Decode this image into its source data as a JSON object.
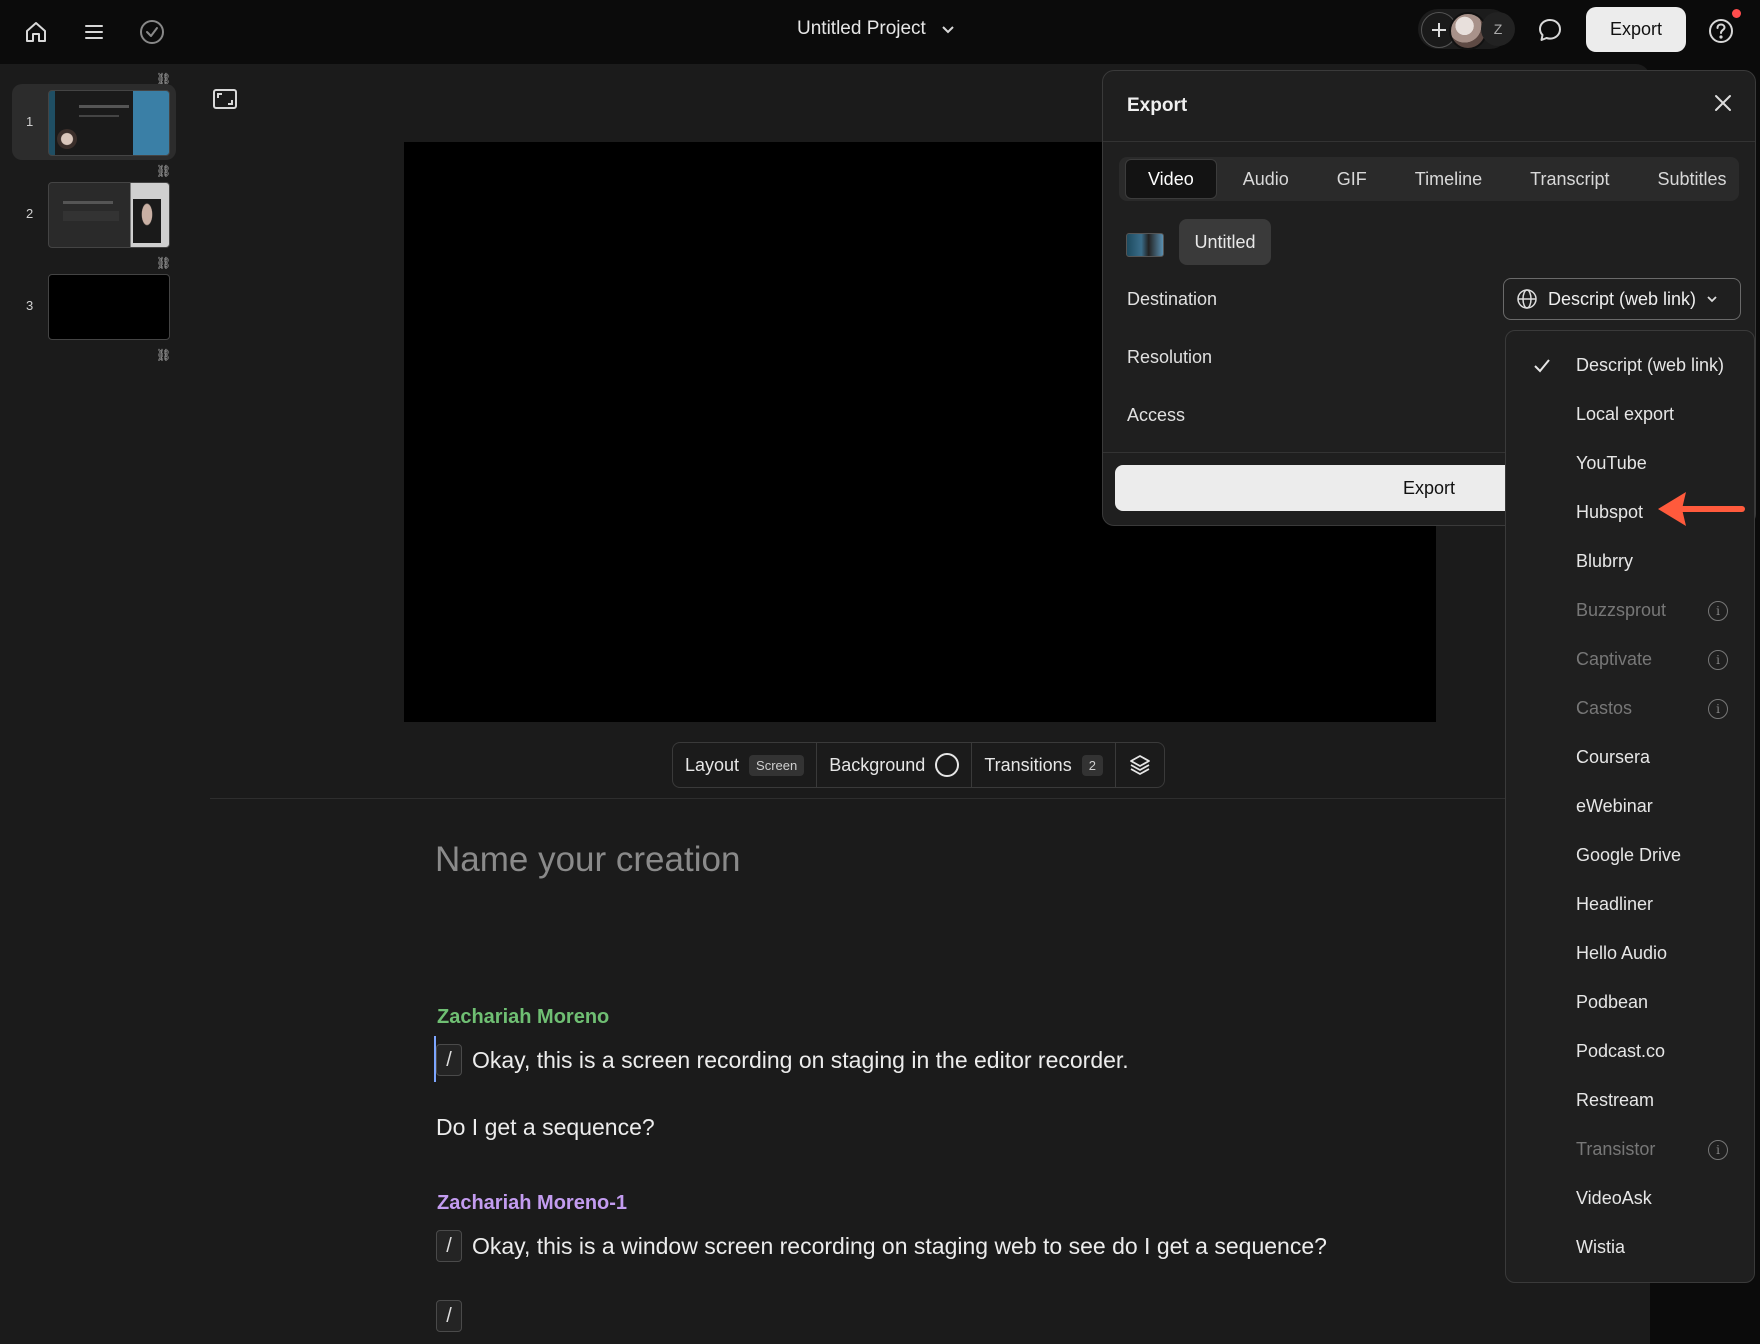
{
  "topbar": {
    "project_title": "Untitled Project",
    "avatar_initial": "Z",
    "export_label": "Export"
  },
  "slides": [
    {
      "number": "1",
      "active": true
    },
    {
      "number": "2",
      "active": false
    },
    {
      "number": "3",
      "active": false
    }
  ],
  "canvas_controls": {
    "layout_label": "Layout",
    "layout_value": "Screen",
    "background_label": "Background",
    "transitions_label": "Transitions",
    "transitions_count": "2"
  },
  "script": {
    "title_placeholder": "Name your creation",
    "blocks": [
      {
        "speaker": "Zachariah Moreno",
        "speaker_color": "#6fbf73",
        "lines": [
          "Okay, this is a screen recording on staging in the editor recorder.",
          "Do I get a sequence?"
        ]
      },
      {
        "speaker": "Zachariah Moreno-1",
        "speaker_color": "#c39cf0",
        "lines": [
          "Okay, this is a window screen recording on staging web to see do I get a sequence?"
        ]
      }
    ],
    "slash": "/"
  },
  "export_panel": {
    "title": "Export",
    "tabs": [
      "Video",
      "Audio",
      "GIF",
      "Timeline",
      "Transcript",
      "Subtitles"
    ],
    "active_tab": "Video",
    "file_name": "Untitled",
    "destination_label": "Destination",
    "resolution_label": "Resolution",
    "access_label": "Access",
    "destination_value": "Descript (web link)",
    "export_button": "Export"
  },
  "destination_menu": {
    "items": [
      {
        "label": "Descript (web link)",
        "selected": true,
        "disabled": false
      },
      {
        "label": "Local export",
        "selected": false,
        "disabled": false
      },
      {
        "label": "YouTube",
        "selected": false,
        "disabled": false
      },
      {
        "label": "Hubspot",
        "selected": false,
        "disabled": false
      },
      {
        "label": "Blubrry",
        "selected": false,
        "disabled": false
      },
      {
        "label": "Buzzsprout",
        "selected": false,
        "disabled": true
      },
      {
        "label": "Captivate",
        "selected": false,
        "disabled": true
      },
      {
        "label": "Castos",
        "selected": false,
        "disabled": true
      },
      {
        "label": "Coursera",
        "selected": false,
        "disabled": false
      },
      {
        "label": "eWebinar",
        "selected": false,
        "disabled": false
      },
      {
        "label": "Google Drive",
        "selected": false,
        "disabled": false
      },
      {
        "label": "Headliner",
        "selected": false,
        "disabled": false
      },
      {
        "label": "Hello Audio",
        "selected": false,
        "disabled": false
      },
      {
        "label": "Podbean",
        "selected": false,
        "disabled": false
      },
      {
        "label": "Podcast.co",
        "selected": false,
        "disabled": false
      },
      {
        "label": "Restream",
        "selected": false,
        "disabled": false
      },
      {
        "label": "Transistor",
        "selected": false,
        "disabled": true
      },
      {
        "label": "VideoAsk",
        "selected": false,
        "disabled": false
      },
      {
        "label": "Wistia",
        "selected": false,
        "disabled": false
      }
    ],
    "annotation_arrow_color": "#ff5a3c"
  }
}
